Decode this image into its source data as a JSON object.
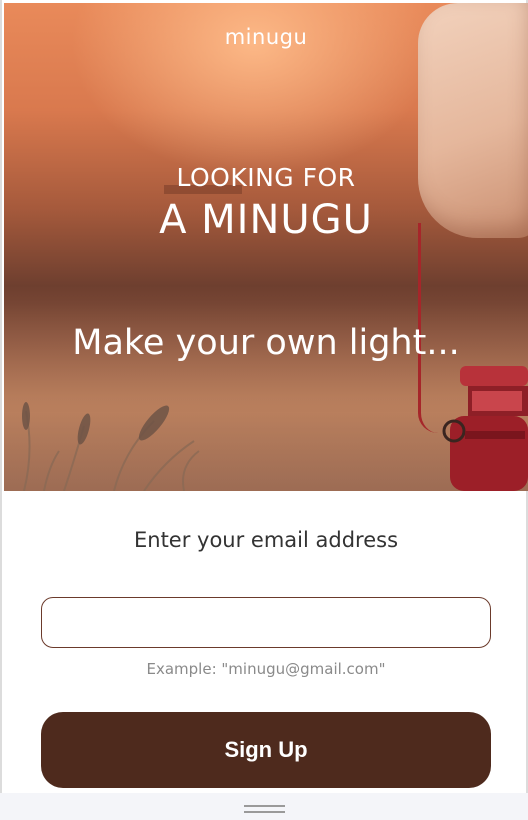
{
  "hero": {
    "brand": "minugu",
    "heading_line1": "LOOKING FOR",
    "heading_line2": "A MINUGU",
    "tagline": "Make your own light..."
  },
  "form": {
    "email_label": "Enter your email address",
    "email_value": "",
    "example_text": "Example: \"minugu@gmail.com\"",
    "signup_label": "Sign Up"
  },
  "colors": {
    "accent": "#4e2a1d",
    "input_border": "#6b3a2b",
    "hero_orange": "#e98a5a",
    "lantern_red": "#a6262a"
  }
}
